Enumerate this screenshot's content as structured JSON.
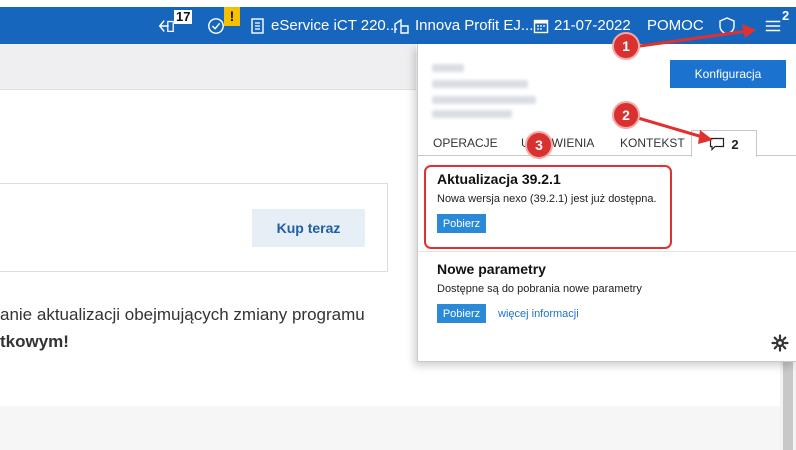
{
  "topbar": {
    "notifications_count": "17",
    "warning_mark": "!",
    "eservice_label": "eService iCT 220...",
    "company_label": "Innova Profit EJ...",
    "date_label": "21-07-2022",
    "help_label": "POMOC",
    "menu_badge": "2",
    "background_color": "#1766be"
  },
  "background": {
    "buy_button_label": "Kup teraz",
    "text_line1": "anie aktualizacji obejmujących zmiany programu",
    "text_line2": "tkowym!"
  },
  "panel": {
    "config_button_label": "Konfiguracja",
    "tabs": [
      {
        "label": "OPERACJE"
      },
      {
        "label": "USTAWIENIA"
      },
      {
        "label": "KONTEKST"
      }
    ],
    "messages_tab_count": "2",
    "notifications": [
      {
        "title": "Aktualizacja 39.2.1",
        "text": "Nowa wersja nexo (39.2.1) jest już dostępna.",
        "action_label": "Pobierz"
      },
      {
        "title": "Nowe parametry",
        "text": "Dostępne są do pobrania nowe parametry",
        "action_label": "Pobierz",
        "link_label": "więcej informacji"
      }
    ]
  },
  "annotations": {
    "callout1": "1",
    "callout2": "2",
    "callout3": "3",
    "color": "#e03131"
  },
  "icons": [
    "logout-icon",
    "check-circle-icon",
    "document-icon",
    "building-icon",
    "calendar-icon",
    "shield-icon",
    "hamburger-menu-icon",
    "chat-bubble-icon",
    "gear-icon"
  ]
}
